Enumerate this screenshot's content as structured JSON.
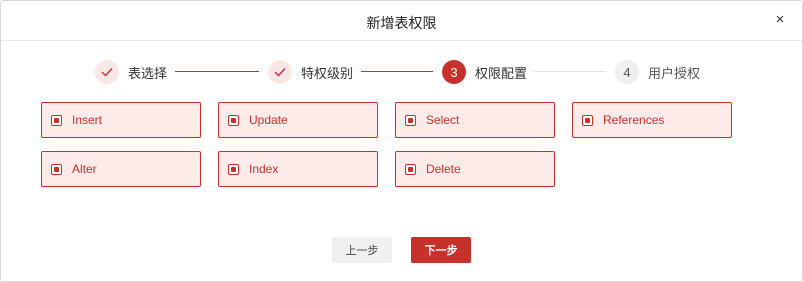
{
  "dialog": {
    "title": "新增表权限",
    "close_label": "×"
  },
  "steps": [
    {
      "label": "表选择",
      "status": "done",
      "marker": "✓"
    },
    {
      "label": "特权级别",
      "status": "done",
      "marker": "✓"
    },
    {
      "label": "权限配置",
      "status": "active",
      "marker": "3"
    },
    {
      "label": "用户授权",
      "status": "pending",
      "marker": "4"
    }
  ],
  "permissions": [
    {
      "label": "Insert",
      "checked": true
    },
    {
      "label": "Update",
      "checked": true
    },
    {
      "label": "Select",
      "checked": true
    },
    {
      "label": "References",
      "checked": true
    },
    {
      "label": "Alter",
      "checked": true
    },
    {
      "label": "Index",
      "checked": true
    },
    {
      "label": "Delete",
      "checked": true
    }
  ],
  "footer": {
    "prev_label": "上一步",
    "next_label": "下一步"
  },
  "colors": {
    "accent": "#c8302c",
    "accent_light": "#fdebea"
  }
}
